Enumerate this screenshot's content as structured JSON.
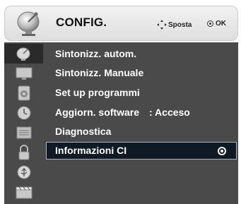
{
  "header": {
    "title": "CONFIG.",
    "hint_move": "Sposta",
    "hint_ok": "OK"
  },
  "sidebar": {
    "icons": [
      "picture-icon",
      "screen-icon",
      "speaker-icon",
      "clock-icon",
      "option-icon",
      "lock-icon",
      "usb-icon",
      "movie-icon"
    ],
    "active_index": 0
  },
  "menu": {
    "items": [
      {
        "label": "Sintonizz. autom.",
        "value": ""
      },
      {
        "label": "Sintonizz. Manuale",
        "value": ""
      },
      {
        "label": "Set up programmi",
        "value": ""
      },
      {
        "label": "Aggiorn. software",
        "value": ": Acceso"
      },
      {
        "label": "Diagnostica",
        "value": ""
      },
      {
        "label": "Informazioni CI",
        "value": ""
      }
    ],
    "selected_index": 5
  },
  "colors": {
    "panel_bg": "#4a4a4a",
    "highlight_bg": "#0f1a24",
    "text": "#ffffff"
  }
}
